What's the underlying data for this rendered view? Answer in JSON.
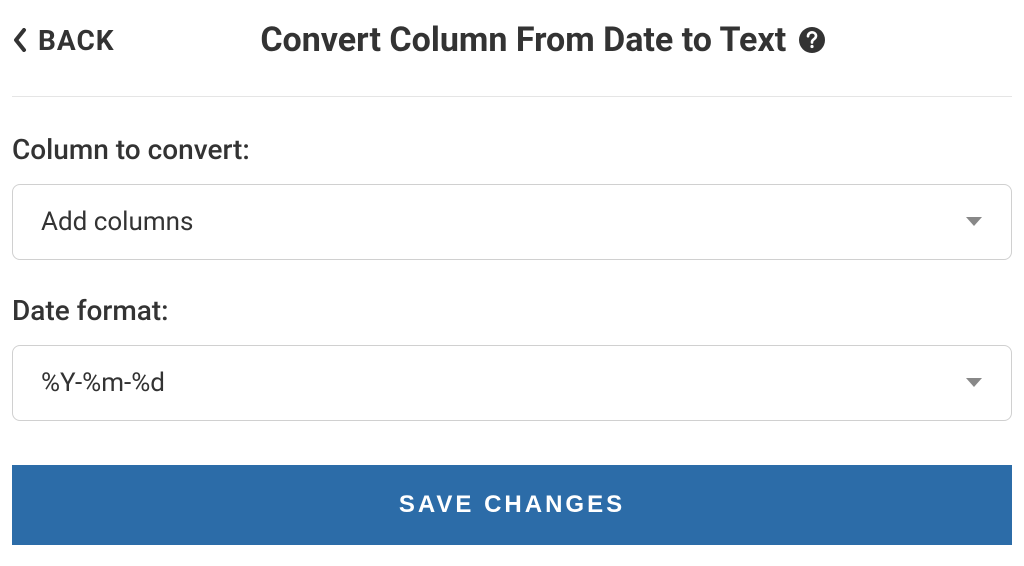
{
  "header": {
    "back_label": "BACK",
    "title": "Convert Column From Date to Text"
  },
  "fields": {
    "column": {
      "label": "Column to convert:",
      "value": "Add columns"
    },
    "date_format": {
      "label": "Date format:",
      "value": "%Y-%m-%d"
    }
  },
  "actions": {
    "save_label": "SAVE CHANGES"
  }
}
